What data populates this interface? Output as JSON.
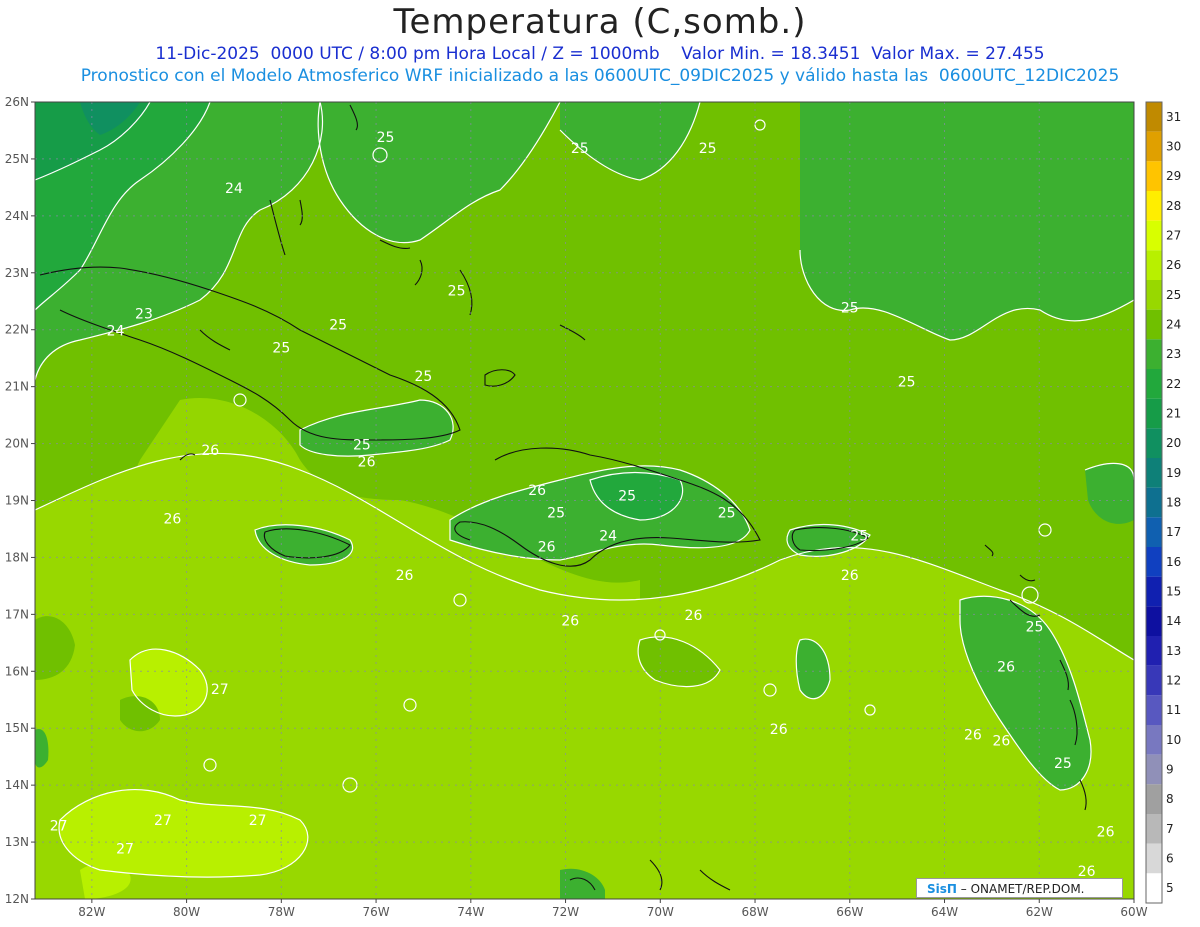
{
  "header": {
    "title": "Temperatura (C,somb.)",
    "subtitle_1": "11-Dic-2025  0000 UTC / 8:00 pm Hora Local / Z = 1000mb    Valor Min. = 18.3451  Valor Max. = 27.455",
    "subtitle_2": "Pronostico con el Modelo Atmosferico WRF inicializado a las 0600UTC_09DIC2025 y válido hasta las  0600UTC_12DIC2025"
  },
  "axes": {
    "lat_labels": [
      "26N",
      "25N",
      "24N",
      "23N",
      "22N",
      "21N",
      "20N",
      "19N",
      "18N",
      "17N",
      "16N",
      "15N",
      "14N",
      "13N",
      "12N"
    ],
    "lon_labels": [
      "82W",
      "80W",
      "78W",
      "76W",
      "74W",
      "72W",
      "70W",
      "68W",
      "66W",
      "64W",
      "62W",
      "60W"
    ]
  },
  "colorbar": {
    "levels": [
      "31",
      "30",
      "29",
      "28",
      "27",
      "26",
      "25",
      "24",
      "23",
      "22",
      "21",
      "20",
      "19",
      "18",
      "17",
      "16",
      "15",
      "14",
      "13",
      "12",
      "11",
      "10",
      "9",
      "8",
      "7",
      "6",
      "5"
    ],
    "colors": [
      "#c08a00",
      "#e0a000",
      "#ffc400",
      "#ffee00",
      "#d8ff00",
      "#b8f000",
      "#98d800",
      "#70c000",
      "#3cb030",
      "#22a83c",
      "#169c48",
      "#109060",
      "#0e8078",
      "#0e7090",
      "#1060b0",
      "#1040c0",
      "#1020b0",
      "#0e10a0",
      "#2020b0",
      "#3838b8",
      "#5858c0",
      "#7878c0",
      "#9090b8",
      "#a0a0a0",
      "#b8b8b8",
      "#d8d8d8",
      "#ffffff"
    ]
  },
  "contour_labels": [
    {
      "text": "25",
      "lon": -75.8,
      "lat": 25.3
    },
    {
      "text": "25",
      "lon": -71.7,
      "lat": 25.1
    },
    {
      "text": "25",
      "lon": -69.0,
      "lat": 25.1
    },
    {
      "text": "24",
      "lon": -79.0,
      "lat": 24.4
    },
    {
      "text": "25",
      "lon": -74.3,
      "lat": 22.6
    },
    {
      "text": "23",
      "lon": -80.9,
      "lat": 22.2
    },
    {
      "text": "24",
      "lon": -81.5,
      "lat": 21.9
    },
    {
      "text": "25",
      "lon": -76.8,
      "lat": 22.0
    },
    {
      "text": "25",
      "lon": -78.0,
      "lat": 21.6
    },
    {
      "text": "25",
      "lon": -75.0,
      "lat": 21.1
    },
    {
      "text": "25",
      "lon": -66.0,
      "lat": 22.3
    },
    {
      "text": "25",
      "lon": -64.8,
      "lat": 21.0
    },
    {
      "text": "26",
      "lon": -79.5,
      "lat": 19.8
    },
    {
      "text": "25",
      "lon": -76.3,
      "lat": 19.9
    },
    {
      "text": "26",
      "lon": -76.2,
      "lat": 19.6
    },
    {
      "text": "26",
      "lon": -72.6,
      "lat": 19.1
    },
    {
      "text": "25",
      "lon": -72.2,
      "lat": 18.7
    },
    {
      "text": "25",
      "lon": -70.7,
      "lat": 19.0
    },
    {
      "text": "25",
      "lon": -68.6,
      "lat": 18.7
    },
    {
      "text": "26",
      "lon": -80.3,
      "lat": 18.6
    },
    {
      "text": "24",
      "lon": -71.1,
      "lat": 18.3
    },
    {
      "text": "26",
      "lon": -72.4,
      "lat": 18.1
    },
    {
      "text": "25",
      "lon": -65.8,
      "lat": 18.3
    },
    {
      "text": "26",
      "lon": -75.4,
      "lat": 17.6
    },
    {
      "text": "26",
      "lon": -66.0,
      "lat": 17.6
    },
    {
      "text": "26",
      "lon": -71.9,
      "lat": 16.8
    },
    {
      "text": "26",
      "lon": -69.3,
      "lat": 16.9
    },
    {
      "text": "25",
      "lon": -62.1,
      "lat": 16.7
    },
    {
      "text": "26",
      "lon": -62.7,
      "lat": 16.0
    },
    {
      "text": "27",
      "lon": -79.3,
      "lat": 15.6
    },
    {
      "text": "26",
      "lon": -67.5,
      "lat": 14.9
    },
    {
      "text": "26",
      "lon": -63.4,
      "lat": 14.8
    },
    {
      "text": "26",
      "lon": -62.8,
      "lat": 14.7
    },
    {
      "text": "25",
      "lon": -61.5,
      "lat": 14.3
    },
    {
      "text": "27",
      "lon": -82.7,
      "lat": 13.2
    },
    {
      "text": "27",
      "lon": -80.5,
      "lat": 13.3
    },
    {
      "text": "27",
      "lon": -78.5,
      "lat": 13.3
    },
    {
      "text": "27",
      "lon": -81.3,
      "lat": 12.8
    },
    {
      "text": "26",
      "lon": -60.6,
      "lat": 13.1
    },
    {
      "text": "26",
      "lon": -61.0,
      "lat": 12.4
    }
  ],
  "credit": {
    "brand": "SisΠ",
    "text": "– ONAMET/REP.DOM."
  }
}
